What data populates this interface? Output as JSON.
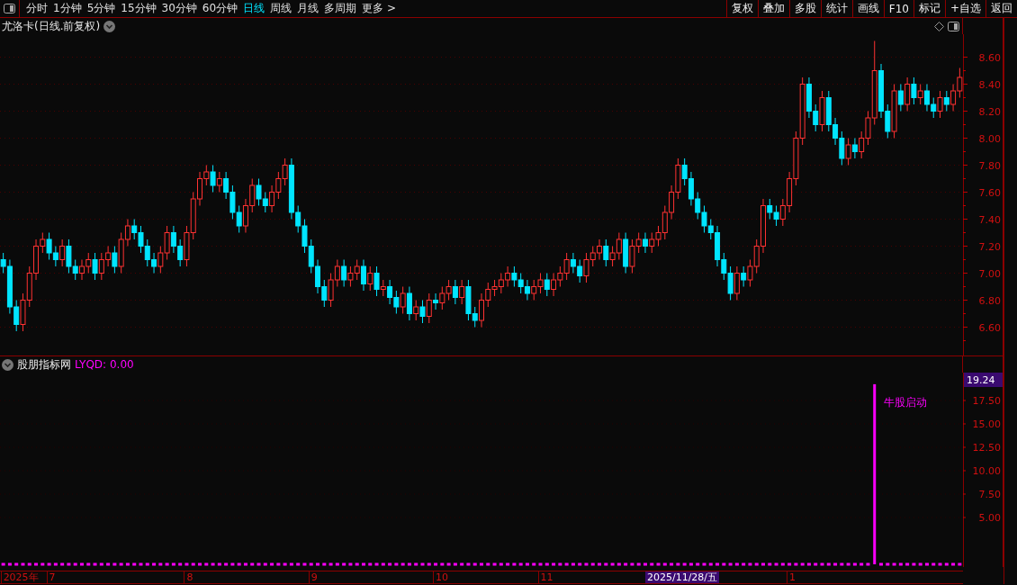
{
  "toolbar": {
    "tabs": [
      {
        "label": "分时",
        "selected": false
      },
      {
        "label": "1分钟",
        "selected": false
      },
      {
        "label": "5分钟",
        "selected": false
      },
      {
        "label": "15分钟",
        "selected": false
      },
      {
        "label": "30分钟",
        "selected": false
      },
      {
        "label": "60分钟",
        "selected": false
      },
      {
        "label": "日线",
        "selected": true
      },
      {
        "label": "周线",
        "selected": false
      },
      {
        "label": "月线",
        "selected": false
      },
      {
        "label": "多周期",
        "selected": false
      },
      {
        "label": "更多 >",
        "selected": false
      }
    ],
    "buttons": [
      "复权",
      "叠加",
      "多股",
      "统计",
      "画线",
      "F10",
      "标记",
      "+自选",
      "返回"
    ]
  },
  "main_chart": {
    "title": "尤洛卡(日线.前复权)",
    "chart_data": {
      "type": "candlestick",
      "grid": true,
      "ylim": [
        6.39,
        8.77
      ],
      "yticks": [
        {
          "value": 8.6,
          "label": "8.60"
        },
        {
          "value": 8.4,
          "label": "8.40"
        },
        {
          "value": 8.2,
          "label": "8.20"
        },
        {
          "value": 8.0,
          "label": "8.00"
        },
        {
          "value": 7.8,
          "label": "7.80"
        },
        {
          "value": 7.6,
          "label": "7.60"
        },
        {
          "value": 7.4,
          "label": "7.40"
        },
        {
          "value": 7.2,
          "label": "7.20"
        },
        {
          "value": 7.0,
          "label": "7.00"
        },
        {
          "value": 6.8,
          "label": "6.80"
        },
        {
          "value": 6.6,
          "label": "6.60"
        }
      ],
      "ohlc": [
        [
          7.1,
          7.15,
          7.0,
          7.05
        ],
        [
          7.05,
          7.1,
          6.7,
          6.75
        ],
        [
          6.75,
          6.8,
          6.57,
          6.62
        ],
        [
          6.62,
          6.85,
          6.57,
          6.8
        ],
        [
          6.8,
          7.05,
          6.75,
          7.0
        ],
        [
          7.0,
          7.25,
          6.95,
          7.2
        ],
        [
          7.2,
          7.3,
          7.15,
          7.25
        ],
        [
          7.25,
          7.3,
          7.1,
          7.15
        ],
        [
          7.15,
          7.2,
          7.05,
          7.1
        ],
        [
          7.1,
          7.25,
          7.05,
          7.2
        ],
        [
          7.2,
          7.25,
          7.0,
          7.05
        ],
        [
          7.05,
          7.1,
          6.95,
          7.0
        ],
        [
          7.0,
          7.1,
          6.95,
          7.05
        ],
        [
          7.05,
          7.15,
          7.0,
          7.1
        ],
        [
          7.1,
          7.15,
          6.95,
          7.0
        ],
        [
          7.0,
          7.15,
          6.95,
          7.1
        ],
        [
          7.1,
          7.2,
          7.05,
          7.15
        ],
        [
          7.15,
          7.2,
          7.0,
          7.05
        ],
        [
          7.05,
          7.3,
          7.0,
          7.25
        ],
        [
          7.25,
          7.4,
          7.2,
          7.35
        ],
        [
          7.35,
          7.4,
          7.25,
          7.3
        ],
        [
          7.3,
          7.35,
          7.15,
          7.2
        ],
        [
          7.2,
          7.25,
          7.05,
          7.1
        ],
        [
          7.1,
          7.15,
          7.0,
          7.05
        ],
        [
          7.05,
          7.2,
          7.0,
          7.15
        ],
        [
          7.15,
          7.35,
          7.1,
          7.3
        ],
        [
          7.3,
          7.35,
          7.15,
          7.2
        ],
        [
          7.2,
          7.25,
          7.05,
          7.1
        ],
        [
          7.1,
          7.35,
          7.05,
          7.3
        ],
        [
          7.3,
          7.6,
          7.25,
          7.55
        ],
        [
          7.55,
          7.75,
          7.5,
          7.7
        ],
        [
          7.7,
          7.8,
          7.65,
          7.75
        ],
        [
          7.75,
          7.8,
          7.6,
          7.65
        ],
        [
          7.65,
          7.75,
          7.6,
          7.7
        ],
        [
          7.7,
          7.75,
          7.55,
          7.6
        ],
        [
          7.6,
          7.65,
          7.4,
          7.45
        ],
        [
          7.45,
          7.5,
          7.3,
          7.35
        ],
        [
          7.35,
          7.55,
          7.3,
          7.5
        ],
        [
          7.5,
          7.7,
          7.45,
          7.65
        ],
        [
          7.65,
          7.7,
          7.5,
          7.55
        ],
        [
          7.55,
          7.6,
          7.45,
          7.5
        ],
        [
          7.5,
          7.65,
          7.45,
          7.6
        ],
        [
          7.6,
          7.75,
          7.55,
          7.7
        ],
        [
          7.7,
          7.85,
          7.65,
          7.8
        ],
        [
          7.8,
          7.85,
          7.4,
          7.45
        ],
        [
          7.45,
          7.5,
          7.3,
          7.35
        ],
        [
          7.35,
          7.4,
          7.15,
          7.2
        ],
        [
          7.2,
          7.25,
          7.0,
          7.05
        ],
        [
          7.05,
          7.1,
          6.85,
          6.9
        ],
        [
          6.9,
          6.95,
          6.75,
          6.8
        ],
        [
          6.8,
          7.0,
          6.75,
          6.95
        ],
        [
          6.95,
          7.1,
          6.9,
          7.05
        ],
        [
          7.05,
          7.1,
          6.9,
          6.95
        ],
        [
          6.95,
          7.05,
          6.9,
          7.0
        ],
        [
          7.0,
          7.1,
          6.95,
          7.05
        ],
        [
          7.05,
          7.1,
          6.87,
          6.92
        ],
        [
          6.92,
          7.05,
          6.87,
          7.0
        ],
        [
          7.0,
          7.05,
          6.83,
          6.88
        ],
        [
          6.88,
          6.95,
          6.83,
          6.9
        ],
        [
          6.9,
          6.95,
          6.77,
          6.82
        ],
        [
          6.82,
          6.87,
          6.7,
          6.75
        ],
        [
          6.75,
          6.9,
          6.7,
          6.85
        ],
        [
          6.85,
          6.9,
          6.65,
          6.7
        ],
        [
          6.7,
          6.8,
          6.65,
          6.75
        ],
        [
          6.75,
          6.8,
          6.63,
          6.68
        ],
        [
          6.68,
          6.85,
          6.63,
          6.8
        ],
        [
          6.8,
          6.85,
          6.73,
          6.78
        ],
        [
          6.78,
          6.9,
          6.73,
          6.85
        ],
        [
          6.85,
          6.95,
          6.8,
          6.9
        ],
        [
          6.9,
          6.95,
          6.77,
          6.82
        ],
        [
          6.82,
          6.95,
          6.77,
          6.9
        ],
        [
          6.9,
          6.95,
          6.65,
          6.7
        ],
        [
          6.7,
          6.75,
          6.6,
          6.65
        ],
        [
          6.65,
          6.85,
          6.6,
          6.8
        ],
        [
          6.8,
          6.93,
          6.75,
          6.88
        ],
        [
          6.88,
          6.95,
          6.83,
          6.9
        ],
        [
          6.9,
          7.0,
          6.85,
          6.95
        ],
        [
          6.95,
          7.05,
          6.9,
          7.0
        ],
        [
          7.0,
          7.05,
          6.9,
          6.95
        ],
        [
          6.95,
          7.0,
          6.85,
          6.9
        ],
        [
          6.9,
          6.95,
          6.8,
          6.85
        ],
        [
          6.85,
          6.95,
          6.8,
          6.9
        ],
        [
          6.9,
          7.0,
          6.85,
          6.95
        ],
        [
          6.95,
          7.0,
          6.83,
          6.88
        ],
        [
          6.88,
          7.0,
          6.83,
          6.95
        ],
        [
          6.95,
          7.05,
          6.9,
          7.0
        ],
        [
          7.0,
          7.15,
          6.95,
          7.1
        ],
        [
          7.1,
          7.15,
          7.0,
          7.05
        ],
        [
          7.05,
          7.1,
          6.93,
          6.98
        ],
        [
          6.98,
          7.15,
          6.93,
          7.1
        ],
        [
          7.1,
          7.2,
          7.05,
          7.15
        ],
        [
          7.15,
          7.25,
          7.1,
          7.2
        ],
        [
          7.2,
          7.25,
          7.05,
          7.1
        ],
        [
          7.1,
          7.2,
          7.05,
          7.15
        ],
        [
          7.15,
          7.3,
          7.1,
          7.25
        ],
        [
          7.25,
          7.3,
          7.0,
          7.05
        ],
        [
          7.05,
          7.25,
          7.0,
          7.2
        ],
        [
          7.2,
          7.3,
          7.15,
          7.25
        ],
        [
          7.25,
          7.3,
          7.15,
          7.2
        ],
        [
          7.2,
          7.3,
          7.15,
          7.25
        ],
        [
          7.25,
          7.35,
          7.2,
          7.3
        ],
        [
          7.3,
          7.5,
          7.25,
          7.45
        ],
        [
          7.45,
          7.65,
          7.4,
          7.6
        ],
        [
          7.6,
          7.85,
          7.55,
          7.8
        ],
        [
          7.8,
          7.85,
          7.65,
          7.7
        ],
        [
          7.7,
          7.75,
          7.5,
          7.55
        ],
        [
          7.55,
          7.6,
          7.4,
          7.45
        ],
        [
          7.45,
          7.5,
          7.3,
          7.35
        ],
        [
          7.35,
          7.4,
          7.25,
          7.3
        ],
        [
          7.3,
          7.35,
          7.05,
          7.1
        ],
        [
          7.1,
          7.15,
          6.95,
          7.0
        ],
        [
          7.0,
          7.05,
          6.8,
          6.85
        ],
        [
          6.85,
          7.05,
          6.8,
          7.0
        ],
        [
          7.0,
          7.05,
          6.9,
          6.95
        ],
        [
          6.95,
          7.1,
          6.9,
          7.05
        ],
        [
          7.05,
          7.25,
          7.0,
          7.2
        ],
        [
          7.2,
          7.55,
          7.15,
          7.5
        ],
        [
          7.5,
          7.55,
          7.4,
          7.45
        ],
        [
          7.45,
          7.5,
          7.35,
          7.4
        ],
        [
          7.4,
          7.55,
          7.35,
          7.5
        ],
        [
          7.5,
          7.75,
          7.45,
          7.7
        ],
        [
          7.7,
          8.05,
          7.65,
          8.0
        ],
        [
          8.0,
          8.45,
          7.95,
          8.4
        ],
        [
          8.4,
          8.45,
          8.15,
          8.2
        ],
        [
          8.2,
          8.25,
          8.05,
          8.1
        ],
        [
          8.1,
          8.35,
          8.05,
          8.3
        ],
        [
          8.3,
          8.35,
          8.05,
          8.1
        ],
        [
          8.1,
          8.15,
          7.95,
          8.0
        ],
        [
          8.0,
          8.05,
          7.8,
          7.85
        ],
        [
          7.85,
          8.0,
          7.8,
          7.95
        ],
        [
          7.95,
          8.0,
          7.85,
          7.9
        ],
        [
          7.9,
          8.05,
          7.85,
          8.0
        ],
        [
          8.0,
          8.2,
          7.95,
          8.15
        ],
        [
          8.15,
          8.72,
          8.1,
          8.5
        ],
        [
          8.5,
          8.55,
          8.15,
          8.2
        ],
        [
          8.2,
          8.25,
          8.0,
          8.05
        ],
        [
          8.05,
          8.4,
          8.0,
          8.35
        ],
        [
          8.35,
          8.4,
          8.2,
          8.25
        ],
        [
          8.25,
          8.45,
          8.2,
          8.4
        ],
        [
          8.4,
          8.45,
          8.25,
          8.3
        ],
        [
          8.3,
          8.4,
          8.25,
          8.35
        ],
        [
          8.35,
          8.4,
          8.2,
          8.25
        ],
        [
          8.25,
          8.3,
          8.15,
          8.2
        ],
        [
          8.2,
          8.35,
          8.15,
          8.3
        ],
        [
          8.3,
          8.35,
          8.2,
          8.25
        ],
        [
          8.25,
          8.4,
          8.2,
          8.35
        ],
        [
          8.35,
          8.52,
          8.3,
          8.45
        ]
      ]
    }
  },
  "indicator": {
    "name": "股朋指标网",
    "reading": "LYQD: 0.00",
    "chart_data": {
      "type": "bar",
      "grid": true,
      "ylim": [
        -0.29,
        20.48
      ],
      "yticks": [
        {
          "value": 17.5,
          "label": "17.50"
        },
        {
          "value": 15,
          "label": "15.00"
        },
        {
          "value": 12.5,
          "label": "12.50"
        },
        {
          "value": 10,
          "label": "10.00"
        },
        {
          "value": 7.5,
          "label": "7.50"
        },
        {
          "value": 5,
          "label": "5.00"
        }
      ],
      "series": [
        {
          "color": "#ff00ff",
          "values": [
            0,
            0,
            0,
            0,
            0,
            0,
            0,
            0,
            0,
            0,
            0,
            0,
            0,
            0,
            0,
            0,
            0,
            0,
            0,
            0,
            0,
            0,
            0,
            0,
            0,
            0,
            0,
            0,
            0,
            0,
            0,
            0,
            0,
            0,
            0,
            0,
            0,
            0,
            0,
            0,
            0,
            0,
            0,
            0,
            0,
            0,
            0,
            0,
            0,
            0,
            0,
            0,
            0,
            0,
            0,
            0,
            0,
            0,
            0,
            0,
            0,
            0,
            0,
            0,
            0,
            0,
            0,
            0,
            0,
            0,
            0,
            0,
            0,
            0,
            0,
            0,
            0,
            0,
            0,
            0,
            0,
            0,
            0,
            0,
            0,
            0,
            0,
            0,
            0,
            0,
            0,
            0,
            0,
            0,
            0,
            0,
            0,
            0,
            0,
            0,
            0,
            0,
            0,
            0,
            0,
            0,
            0,
            0,
            0,
            0,
            0,
            0,
            0,
            0,
            0,
            0,
            0,
            0,
            0,
            0,
            0,
            0,
            0,
            0,
            0,
            0,
            0,
            0,
            0,
            0,
            0,
            0,
            0,
            19.24,
            0,
            0,
            0,
            0,
            0,
            0,
            0,
            0,
            0,
            0,
            0,
            0,
            0
          ]
        }
      ],
      "annotations": [
        {
          "text": "牛股启动"
        }
      ]
    },
    "max_label": "19.24"
  },
  "date_axis": {
    "ticks": [
      "2025年",
      "7",
      "8",
      "9",
      "10",
      "11",
      "1"
    ],
    "cursor": "2025/11/28/五"
  }
}
